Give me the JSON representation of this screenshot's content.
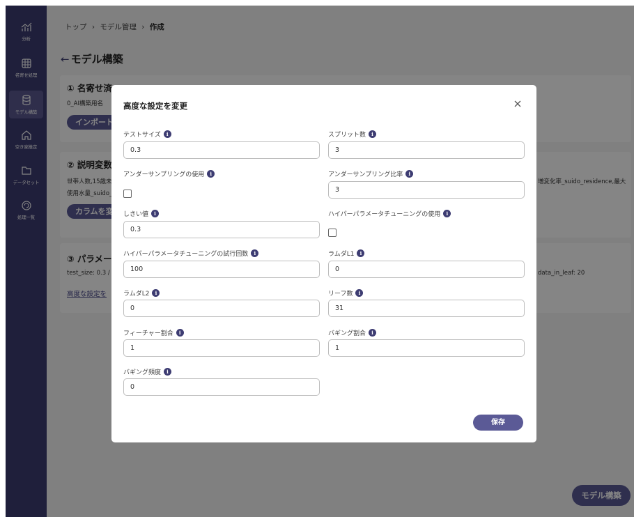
{
  "sidebar": {
    "items": [
      {
        "label": "分析",
        "icon": "analytics-icon"
      },
      {
        "label": "名寄せ処理",
        "icon": "grid-icon"
      },
      {
        "label": "モデル構築",
        "icon": "database-icon"
      },
      {
        "label": "空き家推定",
        "icon": "house-icon"
      },
      {
        "label": "データセット",
        "icon": "folder-icon"
      },
      {
        "label": "処理一覧",
        "icon": "refresh-icon"
      }
    ],
    "active_index": 2
  },
  "breadcrumb": {
    "item1": "トップ",
    "sep1": "›",
    "item2": "モデル管理",
    "sep2": "›",
    "item3": "作成"
  },
  "page": {
    "back_icon": "←",
    "title": "モデル構築"
  },
  "cards": {
    "card1": {
      "title": "① 名寄せ済",
      "text": "0_AI構築用名",
      "button": "インポート"
    },
    "card2": {
      "title": "② 説明変数",
      "text_line1": "世帯人数,15歳未",
      "text_line2": "使用水量_suido_",
      "text_right": "増変化率_suido_residence,最大",
      "button": "カラムを変"
    },
    "card3": {
      "title": "③ パラメー",
      "text": "test_size: 0.3 /",
      "text_right": "data_in_leaf: 20",
      "link": "高度な設定を"
    }
  },
  "build_button": "モデル構築",
  "modal": {
    "title": "高度な設定を変更",
    "close_icon": "✕",
    "fields": {
      "test_size": {
        "label": "テストサイズ",
        "value": "0.3"
      },
      "split_count": {
        "label": "スプリット数",
        "value": "3"
      },
      "undersampling_use": {
        "label": "アンダーサンプリングの使用",
        "checked": false
      },
      "undersampling_ratio": {
        "label": "アンダーサンプリング比率",
        "value": "3"
      },
      "threshold": {
        "label": "しきい値",
        "value": "0.3"
      },
      "hyperparam_use": {
        "label": "ハイパーパラメータチューニングの使用",
        "checked": false
      },
      "hyperparam_trials": {
        "label": "ハイパーパラメータチューニングの試行回数",
        "value": "100"
      },
      "lambda1": {
        "label": "ラムダL1",
        "value": "0"
      },
      "lambda2": {
        "label": "ラムダL2",
        "value": "0"
      },
      "leaf_count": {
        "label": "リーフ数",
        "value": "31"
      },
      "feature_fraction": {
        "label": "フィーチャー割合",
        "value": "1"
      },
      "bagging_fraction": {
        "label": "バギング割合",
        "value": "1"
      },
      "bagging_freq": {
        "label": "バギング頻度",
        "value": "0"
      }
    },
    "info_glyph": "i",
    "save_label": "保存"
  },
  "colors": {
    "sidebar": "#3d3c72",
    "accent": "#5b5a96",
    "background": "#f6f6f6"
  }
}
